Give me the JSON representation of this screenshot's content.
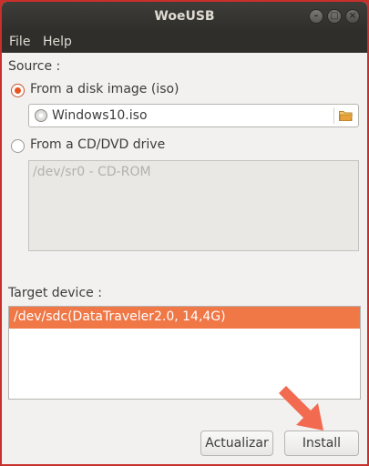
{
  "window": {
    "title": "WoeUSB"
  },
  "window_controls": {
    "minimize": "–",
    "maximize": "□",
    "close": "×"
  },
  "menubar": {
    "file": "File",
    "help": "Help"
  },
  "source": {
    "heading": "Source :",
    "disk_image": {
      "label": "From a disk image (iso)",
      "selected": true,
      "file": "Windows10.iso"
    },
    "cd_dvd": {
      "label": "From a CD/DVD drive",
      "selected": false,
      "drives": [
        "/dev/sr0 - CD-ROM"
      ]
    }
  },
  "target": {
    "heading": "Target device :",
    "devices": [
      "/dev/sdc(DataTraveler2.0, 14,4G)"
    ]
  },
  "buttons": {
    "refresh": "Actualizar",
    "install": "Install"
  },
  "colors": {
    "accent": "#e95420",
    "selection": "#f07746",
    "arrow": "#f26a4f",
    "titlebar": "#2f2e2b"
  },
  "icons": {
    "disc": "disc-icon",
    "folder": "folder-open-icon",
    "pointer": "arrow-pointer-icon"
  }
}
